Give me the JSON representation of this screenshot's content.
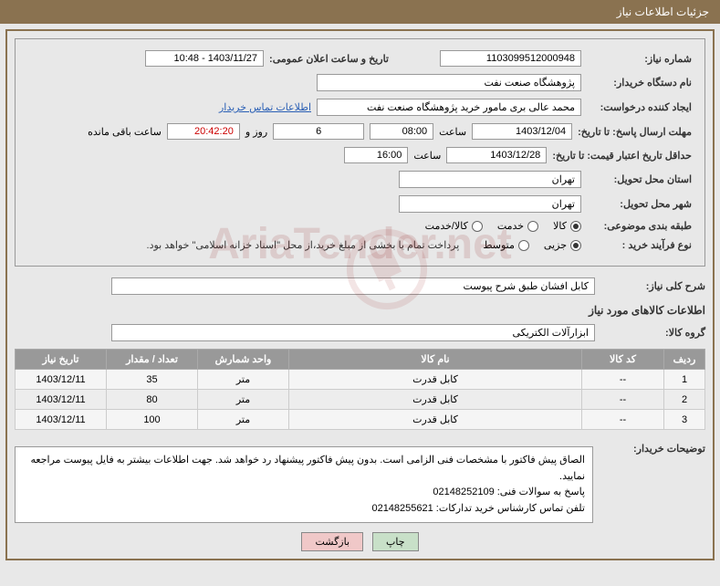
{
  "page_title": "جزئیات اطلاعات نیاز",
  "watermark_text": "AriaTender.net",
  "labels": {
    "need_number": "شماره نیاز:",
    "announce_datetime": "تاریخ و ساعت اعلان عمومی:",
    "buyer_name": "نام دستگاه خریدار:",
    "request_creator": "ایجاد کننده درخواست:",
    "buyer_contact": "اطلاعات تماس خریدار",
    "response_deadline": "مهلت ارسال پاسخ: تا تاریخ:",
    "hour_label": "ساعت",
    "days_and": "روز و",
    "remaining": "ساعت باقی مانده",
    "price_validity": "حداقل تاریخ اعتبار قیمت: تا تاریخ:",
    "delivery_province": "استان محل تحویل:",
    "delivery_city": "شهر محل تحویل:",
    "subject_category": "طبقه بندی موضوعی:",
    "purchase_process": "نوع فرآیند خرید :",
    "overall_desc": "شرح کلی نیاز:",
    "goods_info_title": "اطلاعات کالاهای مورد نیاز",
    "goods_group": "گروه کالا:",
    "buyer_notes": "توضیحات خریدار:"
  },
  "values": {
    "need_number": "1103099512000948",
    "announce_datetime": "1403/11/27 - 10:48",
    "buyer_name": "پژوهشگاه صنعت نفت",
    "request_creator": "محمد عالی بری مامور خرید پژوهشگاه صنعت نفت",
    "response_date": "1403/12/04",
    "response_hour": "08:00",
    "days_remaining": "6",
    "time_remaining": "20:42:20",
    "price_validity_date": "1403/12/28",
    "price_validity_hour": "16:00",
    "delivery_province": "تهران",
    "delivery_city": "تهران",
    "payment_note": "پرداخت تمام یا بخشی از مبلغ خرید،از محل \"اسناد خزانه اسلامی\" خواهد بود.",
    "overall_desc": "کابل افشان طبق شرح پیوست",
    "goods_group": "ابزارآلات الکتریکی",
    "buyer_notes_l1": "الصاق پیش فاکتور با مشخصات فنی الزامی است. بدون پیش فاکتور پیشنهاد رد خواهد شد. جهت اطلاعات بیشتر به فایل پیوست مراجعه نمایید.",
    "buyer_notes_l2": "پاسخ به سوالات فنی: 02148252109",
    "buyer_notes_l3": "تلفن تماس کارشناس خرید تدارکات: 02148255621"
  },
  "radios": {
    "category": {
      "goods": "کالا",
      "service": "خدمت",
      "goods_service": "کالا/خدمت",
      "selected": "goods"
    },
    "process": {
      "partial": "جزیی",
      "medium": "متوسط",
      "selected": "partial"
    }
  },
  "table": {
    "headers": {
      "row": "ردیف",
      "code": "کد کالا",
      "name": "نام کالا",
      "unit": "واحد شمارش",
      "qty": "تعداد / مقدار",
      "need_date": "تاریخ نیاز"
    },
    "rows": [
      {
        "row": "1",
        "code": "--",
        "name": "کابل قدرت",
        "unit": "متر",
        "qty": "35",
        "need_date": "1403/12/11"
      },
      {
        "row": "2",
        "code": "--",
        "name": "کابل قدرت",
        "unit": "متر",
        "qty": "80",
        "need_date": "1403/12/11"
      },
      {
        "row": "3",
        "code": "--",
        "name": "کابل قدرت",
        "unit": "متر",
        "qty": "100",
        "need_date": "1403/12/11"
      }
    ]
  },
  "buttons": {
    "print": "چاپ",
    "back": "بازگشت"
  }
}
